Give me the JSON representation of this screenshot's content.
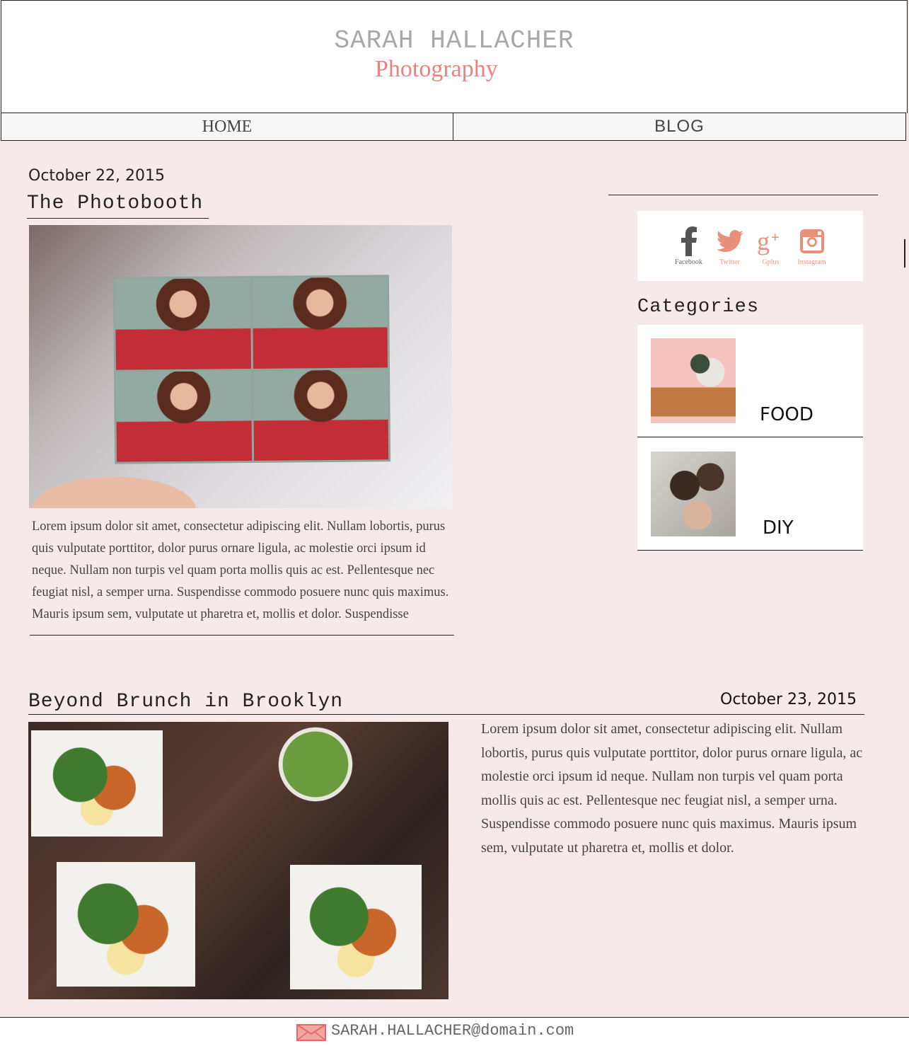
{
  "header": {
    "brand_name": "SARAH HALLACHER",
    "brand_sub": "Photography"
  },
  "nav": {
    "items": [
      {
        "label": "HOME"
      },
      {
        "label": "BLOG"
      }
    ]
  },
  "posts": [
    {
      "date": "October 22, 2015",
      "title": "The Photobooth",
      "body": "Lorem ipsum dolor sit amet, consectetur adipiscing elit. Nullam lobortis, purus quis vulputate porttitor, dolor purus ornare ligula, ac molestie orci ipsum id neque. Nullam non turpis vel quam porta mollis quis ac est. Pellentesque nec feugiat nisl, a semper urna. Suspendisse commodo posuere nunc quis maximus. Mauris ipsum sem, vulputate ut pharetra et, mollis et dolor. Suspendisse"
    },
    {
      "date": "October 23, 2015",
      "title": "Beyond Brunch in Brooklyn",
      "body": "Lorem ipsum dolor sit amet, consectetur adipiscing elit. Nullam lobortis, purus quis vulputate porttitor, dolor purus ornare ligula, ac molestie orci ipsum id neque. Nullam non turpis vel quam porta mollis quis ac est. Pellentesque nec feugiat nisl, a semper urna. Suspendisse commodo posuere nunc quis maximus. Mauris ipsum sem, vulputate ut pharetra et, mollis et dolor."
    }
  ],
  "sidebar": {
    "social": [
      {
        "label": "Facebook",
        "icon": "facebook-icon",
        "color": "#555555"
      },
      {
        "label": "Twitter",
        "icon": "twitter-icon",
        "color": "#e8907a"
      },
      {
        "label": "Gplus",
        "icon": "google-plus-icon",
        "color": "#e8907a"
      },
      {
        "label": "Instagram",
        "icon": "instagram-icon",
        "color": "#e8907a"
      }
    ],
    "categories_heading": "Categories",
    "categories": [
      {
        "label": "FOOD"
      },
      {
        "label": "DIY"
      }
    ]
  },
  "footer": {
    "email": "SARAH.HALLACHER@domain.com",
    "icon": "envelope-icon",
    "icon_color": "#e8666a"
  },
  "colors": {
    "background": "#f6e9e9",
    "accent": "#ef8080"
  }
}
